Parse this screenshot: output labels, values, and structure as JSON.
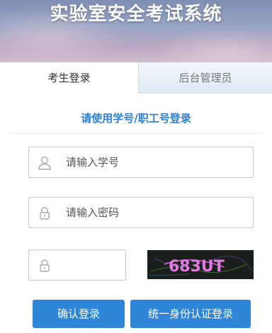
{
  "banner": {
    "title": "实验室安全考试系统"
  },
  "tabs": [
    {
      "label": "考生登录",
      "active": true
    },
    {
      "label": "后台管理员",
      "active": false
    }
  ],
  "form": {
    "subtitle": "请使用学号/职工号登录",
    "username_placeholder": "请输入学号",
    "password_placeholder": "请输入密码",
    "captcha_placeholder": "",
    "captcha_text": "683UT",
    "login_button": "确认登录",
    "sso_button": "统一身份认证登录"
  },
  "colors": {
    "accent": "#2d7fcf",
    "button": "#2f86d9"
  },
  "icons": {
    "user": "user-icon",
    "lock": "lock-icon"
  }
}
